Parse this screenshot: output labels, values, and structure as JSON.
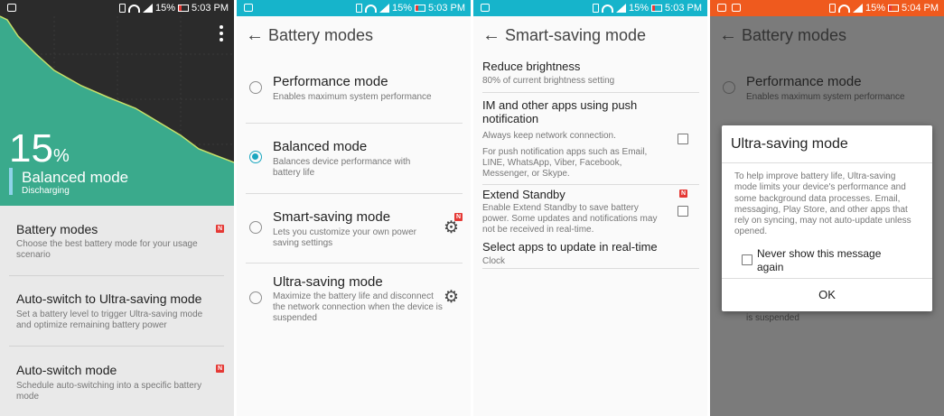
{
  "status_bar": {
    "battery_percent": "15%",
    "time_1": "5:03 PM",
    "time_2": "5:04 PM"
  },
  "colors": {
    "status_teal": "#16b4cb",
    "status_orange": "#ef5a1e",
    "chart_green": "#3aaa8c",
    "accent": "#1aa6bf",
    "badge_red": "#e53935"
  },
  "battery_screen": {
    "level_number": "15",
    "level_unit": "%",
    "mode": "Balanced mode",
    "status": "Discharging",
    "menu_icon": "overflow-menu-icon",
    "items": [
      {
        "title": "Battery modes",
        "subtitle": "Choose the best battery mode for your usage scenario",
        "badge": "N"
      },
      {
        "title": "Auto-switch to Ultra-saving mode",
        "subtitle": "Set a battery level to trigger Ultra-saving mode and optimize remaining battery power",
        "badge": ""
      },
      {
        "title": "Auto-switch mode",
        "subtitle": "Schedule auto-switching into a specific battery mode",
        "badge": "N"
      }
    ]
  },
  "battery_modes": {
    "title": "Battery modes",
    "modes": [
      {
        "title": "Performance mode",
        "subtitle": "Enables maximum system performance",
        "selected": false
      },
      {
        "title": "Balanced mode",
        "subtitle": "Balances device performance with battery life",
        "selected": true
      },
      {
        "title": "Smart-saving mode",
        "subtitle": "Lets you customize your own power saving settings",
        "selected": false,
        "badge": "N"
      },
      {
        "title": "Ultra-saving mode",
        "subtitle": "Maximize the battery life and disconnect the network connection when the device is suspended",
        "selected": false
      }
    ]
  },
  "smart_saving": {
    "title": "Smart-saving mode",
    "reduce_brightness_title": "Reduce brightness",
    "reduce_brightness_sub": "80% of current brightness setting",
    "im_title": "IM and other apps using push notification",
    "im_sub_1": "Always keep network connection.",
    "im_sub_2": "For push notification apps such as Email, LINE, WhatsApp, Viber, Facebook, Messenger, or Skype.",
    "extend_title": "Extend Standby",
    "extend_badge": "N",
    "extend_sub": "Enable Extend Standby to save battery power. Some updates and notifications may not be received in real-time.",
    "select_title": "Select apps to update in real-time",
    "select_sub": "Clock"
  },
  "ultra_dialog_screen": {
    "title": "Battery modes",
    "performance_title": "Performance mode",
    "performance_sub": "Enables maximum system performance",
    "suspended_fragment": "is suspended",
    "dialog": {
      "title": "Ultra-saving mode",
      "body": "To help improve battery life, Ultra-saving mode limits your device's performance and some background data processes. Email, messaging, Play Store, and other apps that rely on syncing, may not auto-update unless opened.",
      "checkbox_label": "Never show this message again",
      "ok": "OK"
    }
  }
}
